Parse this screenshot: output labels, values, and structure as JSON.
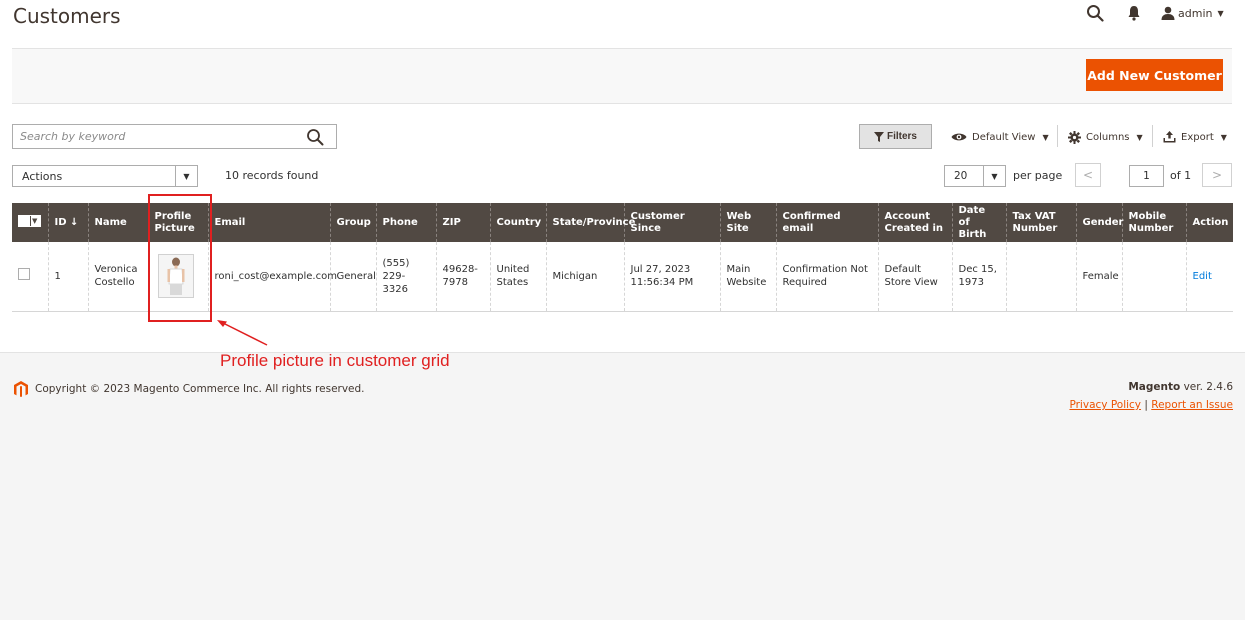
{
  "header": {
    "title": "Customers",
    "user_label": "admin"
  },
  "page_actions": {
    "add_button": "Add New Customer"
  },
  "toolbar": {
    "search_placeholder": "Search by keyword",
    "filters_label": "Filters",
    "view_label": "Default View",
    "columns_label": "Columns",
    "export_label": "Export"
  },
  "grid_controls": {
    "actions_label": "Actions",
    "records_found": "10 records found",
    "per_page_value": "20",
    "per_page_label": "per page",
    "current_page": "1",
    "of_pages": "of 1"
  },
  "columns": [
    {
      "label": "ID ↓"
    },
    {
      "label": "Name"
    },
    {
      "label": "Profile Picture"
    },
    {
      "label": "Email"
    },
    {
      "label": "Group"
    },
    {
      "label": "Phone"
    },
    {
      "label": "ZIP"
    },
    {
      "label": "Country"
    },
    {
      "label": "State/Province"
    },
    {
      "label": "Customer Since"
    },
    {
      "label": "Web Site"
    },
    {
      "label": "Confirmed email"
    },
    {
      "label": "Account Created in"
    },
    {
      "label": "Date of Birth"
    },
    {
      "label": "Tax VAT Number"
    },
    {
      "label": "Gender"
    },
    {
      "label": "Mobile Number"
    },
    {
      "label": "Action"
    }
  ],
  "rows": [
    {
      "id": "1",
      "name": "Veronica Costello",
      "email": "roni_cost@example.com",
      "group": "General",
      "phone": "(555) 229-3326",
      "zip": "49628-7978",
      "country": "United States",
      "state": "Michigan",
      "customer_since": "Jul 27, 2023 11:56:34 PM",
      "website": "Main Website",
      "confirmed_email": "Confirmation Not Required",
      "account_created_in": "Default Store View",
      "dob": "Dec 15, 1973",
      "tax_vat": "",
      "gender": "Female",
      "mobile": "",
      "action": "Edit"
    }
  ],
  "annotation": {
    "text": "Profile picture in customer grid",
    "color": "#e02020"
  },
  "footer": {
    "copyright": "Copyright © 2023 Magento Commerce Inc. All rights reserved.",
    "brand": "Magento",
    "version": "ver. 2.4.6",
    "privacy_link": "Privacy Policy",
    "separator": "|",
    "report_link": "Report an Issue"
  },
  "colors": {
    "accent": "#eb5202",
    "grid_header": "#514943",
    "link": "#007bdb"
  }
}
